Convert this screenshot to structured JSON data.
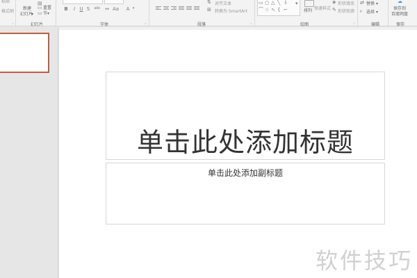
{
  "ribbon": {
    "clipboard": {
      "format_painter_label": "格式刷"
    },
    "slides": {
      "new_slide_label": "新建",
      "new_slide_sub_label": "幻灯片",
      "reset_label": "重置",
      "section_label": "节",
      "group_label": "幻灯片"
    },
    "font": {
      "group_label": "字体",
      "bold": "B",
      "italic": "I",
      "underline": "U",
      "strike": "S",
      "shadow": "abc"
    },
    "paragraph": {
      "group_label": "段落",
      "text_align_label": "对齐文本",
      "smartart_label": "转换为 SmartArt"
    },
    "drawing": {
      "group_label": "绘图",
      "arrange_label": "排列",
      "quick_styles_label": "快速样式",
      "shape_fill_label": "形状填充",
      "shape_outline_label": "形状轮廓"
    },
    "editing": {
      "group_label": "编辑",
      "replace_label": "替换",
      "select_label": "选择"
    },
    "save": {
      "group_label": "保存",
      "save_to_label": "保存到",
      "baidu_label": "百度网盘"
    }
  },
  "slide": {
    "title_placeholder": "单击此处添加标题",
    "subtitle_placeholder": "单击此处添加副标题"
  },
  "watermark": "软件技巧",
  "colors": {
    "thumb_border": "#c55a3b",
    "ribbon_bg": "#f3f3f3",
    "workspace_bg": "#e6e6e6"
  }
}
